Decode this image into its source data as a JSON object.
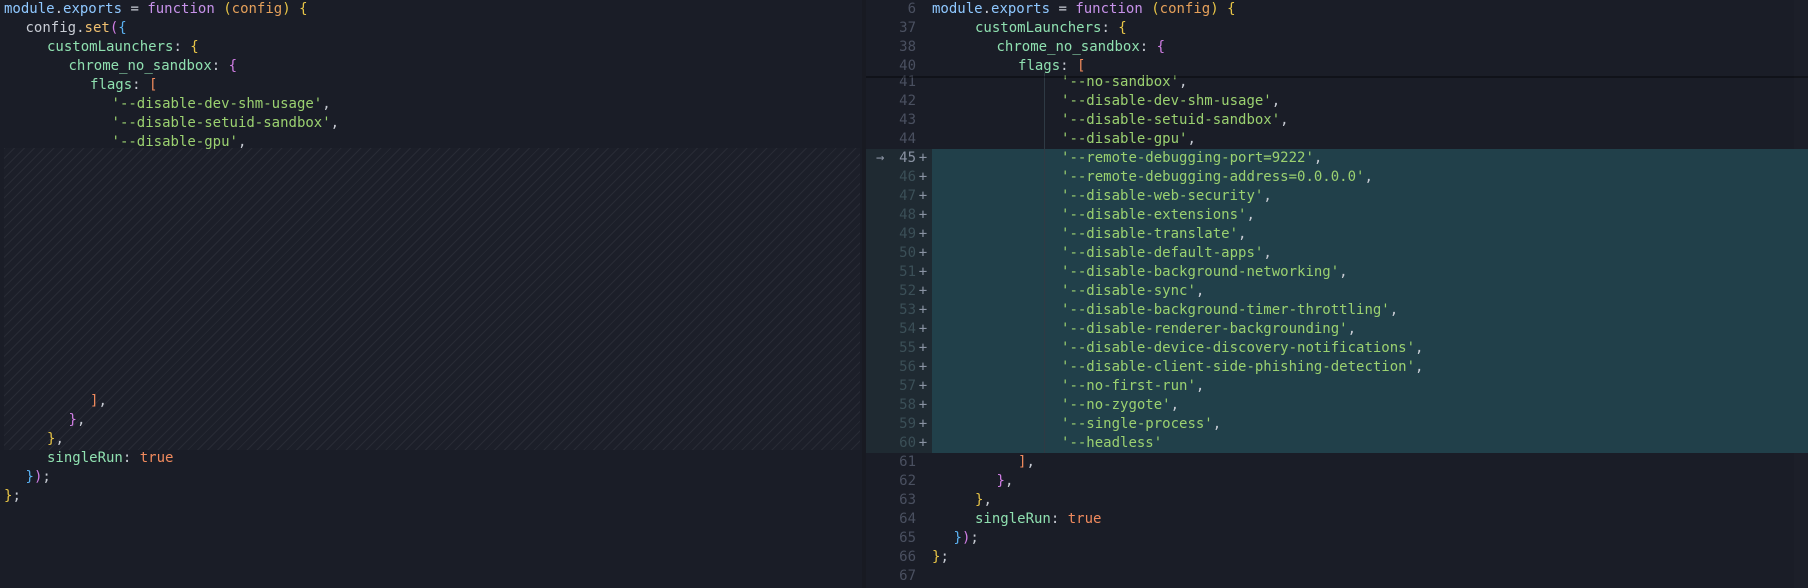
{
  "left": {
    "lines": [
      {
        "indent": 0,
        "tokens": [
          [
            "obj",
            "module"
          ],
          [
            "pun",
            "."
          ],
          [
            "obj",
            "exports"
          ],
          [
            "pun",
            " = "
          ],
          [
            "fnkw",
            "function"
          ],
          [
            "pun",
            " "
          ],
          [
            "brkt1",
            "("
          ],
          [
            "prm",
            "config"
          ],
          [
            "brkt1",
            ")"
          ],
          [
            "pun",
            " "
          ],
          [
            "brkt1",
            "{"
          ]
        ]
      },
      {
        "indent": 2,
        "tokens": [
          [
            "plain",
            "config"
          ],
          [
            "pun",
            "."
          ],
          [
            "fn",
            "set"
          ],
          [
            "brkt2",
            "("
          ],
          [
            "brkt3",
            "{"
          ]
        ]
      },
      {
        "indent": 4,
        "tokens": [
          [
            "prop",
            "customLaunchers"
          ],
          [
            "pun",
            ": "
          ],
          [
            "brkt1",
            "{"
          ]
        ]
      },
      {
        "indent": 6,
        "tokens": [
          [
            "prop",
            "chrome_no_sandbox"
          ],
          [
            "pun",
            ": "
          ],
          [
            "brkt2",
            "{"
          ]
        ]
      },
      {
        "indent": 8,
        "tokens": [
          [
            "prop",
            "flags"
          ],
          [
            "pun",
            ": "
          ],
          [
            "bool",
            "["
          ]
        ]
      },
      {
        "indent": 10,
        "tokens": [
          [
            "str",
            "'--disable-dev-shm-usage'"
          ],
          [
            "pun",
            ","
          ]
        ]
      },
      {
        "indent": 10,
        "tokens": [
          [
            "str",
            "'--disable-setuid-sandbox'"
          ],
          [
            "pun",
            ","
          ]
        ]
      },
      {
        "indent": 10,
        "tokens": [
          [
            "str",
            "'--disable-gpu'"
          ],
          [
            "pun",
            ","
          ]
        ]
      }
    ],
    "tail_lines": [
      {
        "indent": 8,
        "tokens": [
          [
            "bool",
            "]"
          ],
          [
            "pun",
            ","
          ]
        ]
      },
      {
        "indent": 6,
        "tokens": [
          [
            "brkt2",
            "}"
          ],
          [
            "pun",
            ","
          ]
        ]
      },
      {
        "indent": 4,
        "tokens": [
          [
            "brkt1",
            "}"
          ],
          [
            "pun",
            ","
          ]
        ]
      },
      {
        "indent": 4,
        "tokens": [
          [
            "prop",
            "singleRun"
          ],
          [
            "pun",
            ": "
          ],
          [
            "bool",
            "true"
          ]
        ]
      },
      {
        "indent": 2,
        "tokens": [
          [
            "brkt3",
            "}"
          ],
          [
            "brkt2",
            ")"
          ],
          [
            "pun",
            ";"
          ]
        ]
      },
      {
        "indent": 0,
        "tokens": [
          [
            "brkt1",
            "}"
          ],
          [
            "pun",
            ";"
          ]
        ]
      }
    ]
  },
  "right": {
    "sticky": [
      {
        "num": "6",
        "indent": 0,
        "tokens": [
          [
            "obj",
            "module"
          ],
          [
            "pun",
            "."
          ],
          [
            "obj",
            "exports"
          ],
          [
            "pun",
            " = "
          ],
          [
            "fnkw",
            "function"
          ],
          [
            "pun",
            " "
          ],
          [
            "brkt1",
            "("
          ],
          [
            "prm",
            "config"
          ],
          [
            "brkt1",
            ")"
          ],
          [
            "pun",
            " "
          ],
          [
            "brkt1",
            "{"
          ]
        ]
      },
      {
        "num": "37",
        "indent": 4,
        "tokens": [
          [
            "prop",
            "customLaunchers"
          ],
          [
            "pun",
            ": "
          ],
          [
            "brkt1",
            "{"
          ]
        ]
      },
      {
        "num": "38",
        "indent": 6,
        "tokens": [
          [
            "prop",
            "chrome_no_sandbox"
          ],
          [
            "pun",
            ": "
          ],
          [
            "brkt2",
            "{"
          ]
        ]
      },
      {
        "num": "40",
        "indent": 8,
        "tokens": [
          [
            "prop",
            "flags"
          ],
          [
            "pun",
            ": "
          ],
          [
            "bool",
            "["
          ]
        ]
      }
    ],
    "lines": [
      {
        "num": "41",
        "added": false,
        "indent": 12,
        "tokens": [
          [
            "str",
            "'--no-sandbox'"
          ],
          [
            "pun",
            ","
          ]
        ]
      },
      {
        "num": "42",
        "added": false,
        "indent": 12,
        "tokens": [
          [
            "str",
            "'--disable-dev-shm-usage'"
          ],
          [
            "pun",
            ","
          ]
        ]
      },
      {
        "num": "43",
        "added": false,
        "indent": 12,
        "tokens": [
          [
            "str",
            "'--disable-setuid-sandbox'"
          ],
          [
            "pun",
            ","
          ]
        ]
      },
      {
        "num": "44",
        "added": false,
        "indent": 12,
        "tokens": [
          [
            "str",
            "'--disable-gpu'"
          ],
          [
            "pun",
            ","
          ]
        ]
      },
      {
        "num": "45",
        "added": true,
        "current": true,
        "indent": 12,
        "tokens": [
          [
            "str",
            "'--remote-debugging-port=9222'"
          ],
          [
            "pun",
            ","
          ]
        ]
      },
      {
        "num": "46",
        "added": true,
        "indent": 12,
        "tokens": [
          [
            "str",
            "'--remote-debugging-address=0.0.0.0'"
          ],
          [
            "pun",
            ","
          ]
        ]
      },
      {
        "num": "47",
        "added": true,
        "indent": 12,
        "tokens": [
          [
            "str",
            "'--disable-web-security'"
          ],
          [
            "pun",
            ","
          ]
        ]
      },
      {
        "num": "48",
        "added": true,
        "indent": 12,
        "tokens": [
          [
            "str",
            "'--disable-extensions'"
          ],
          [
            "pun",
            ","
          ]
        ]
      },
      {
        "num": "49",
        "added": true,
        "indent": 12,
        "tokens": [
          [
            "str",
            "'--disable-translate'"
          ],
          [
            "pun",
            ","
          ]
        ]
      },
      {
        "num": "50",
        "added": true,
        "indent": 12,
        "tokens": [
          [
            "str",
            "'--disable-default-apps'"
          ],
          [
            "pun",
            ","
          ]
        ]
      },
      {
        "num": "51",
        "added": true,
        "indent": 12,
        "tokens": [
          [
            "str",
            "'--disable-background-networking'"
          ],
          [
            "pun",
            ","
          ]
        ]
      },
      {
        "num": "52",
        "added": true,
        "indent": 12,
        "tokens": [
          [
            "str",
            "'--disable-sync'"
          ],
          [
            "pun",
            ","
          ]
        ]
      },
      {
        "num": "53",
        "added": true,
        "indent": 12,
        "tokens": [
          [
            "str",
            "'--disable-background-timer-throttling'"
          ],
          [
            "pun",
            ","
          ]
        ]
      },
      {
        "num": "54",
        "added": true,
        "indent": 12,
        "tokens": [
          [
            "str",
            "'--disable-renderer-backgrounding'"
          ],
          [
            "pun",
            ","
          ]
        ]
      },
      {
        "num": "55",
        "added": true,
        "indent": 12,
        "tokens": [
          [
            "str",
            "'--disable-device-discovery-notifications'"
          ],
          [
            "pun",
            ","
          ]
        ]
      },
      {
        "num": "56",
        "added": true,
        "indent": 12,
        "tokens": [
          [
            "str",
            "'--disable-client-side-phishing-detection'"
          ],
          [
            "pun",
            ","
          ]
        ]
      },
      {
        "num": "57",
        "added": true,
        "indent": 12,
        "tokens": [
          [
            "str",
            "'--no-first-run'"
          ],
          [
            "pun",
            ","
          ]
        ]
      },
      {
        "num": "58",
        "added": true,
        "indent": 12,
        "tokens": [
          [
            "str",
            "'--no-zygote'"
          ],
          [
            "pun",
            ","
          ]
        ]
      },
      {
        "num": "59",
        "added": true,
        "indent": 12,
        "tokens": [
          [
            "str",
            "'--single-process'"
          ],
          [
            "pun",
            ","
          ]
        ]
      },
      {
        "num": "60",
        "added": true,
        "indent": 12,
        "tokens": [
          [
            "str",
            "'--headless'"
          ]
        ]
      },
      {
        "num": "61",
        "added": false,
        "indent": 8,
        "tokens": [
          [
            "bool",
            "]"
          ],
          [
            "pun",
            ","
          ]
        ]
      },
      {
        "num": "62",
        "added": false,
        "indent": 6,
        "tokens": [
          [
            "brkt2",
            "}"
          ],
          [
            "pun",
            ","
          ]
        ]
      },
      {
        "num": "63",
        "added": false,
        "indent": 4,
        "tokens": [
          [
            "brkt1",
            "}"
          ],
          [
            "pun",
            ","
          ]
        ]
      },
      {
        "num": "64",
        "added": false,
        "indent": 4,
        "tokens": [
          [
            "prop",
            "singleRun"
          ],
          [
            "pun",
            ": "
          ],
          [
            "bool",
            "true"
          ]
        ]
      },
      {
        "num": "65",
        "added": false,
        "indent": 2,
        "tokens": [
          [
            "brkt3",
            "}"
          ],
          [
            "brkt2",
            ")"
          ],
          [
            "pun",
            ";"
          ]
        ]
      },
      {
        "num": "66",
        "added": false,
        "indent": 0,
        "tokens": [
          [
            "brkt1",
            "}"
          ],
          [
            "pun",
            ";"
          ]
        ]
      },
      {
        "num": "67",
        "added": false,
        "indent": 0,
        "tokens": []
      }
    ],
    "added_marker": "+",
    "current_arrow": "→"
  }
}
